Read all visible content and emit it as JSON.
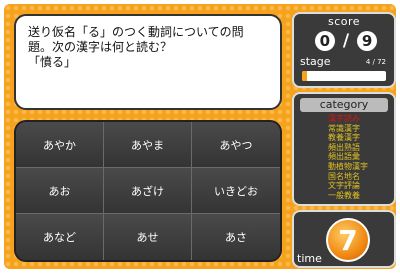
{
  "question": {
    "line1": "送り仮名「る」のつく動詞についての問",
    "line2": "題。次の漢字は何と読む？",
    "line3": "「憤る」"
  },
  "answers": [
    "あやか",
    "あやま",
    "あやつ",
    "あお",
    "あざけ",
    "いきどお",
    "あなど",
    "あせ",
    "あさ"
  ],
  "score": {
    "title": "score",
    "correct": "0",
    "sep": "/",
    "total": "9"
  },
  "stage": {
    "label": "stage",
    "value": "4 / 72",
    "progress": 0.06
  },
  "category": {
    "title": "category",
    "items": [
      {
        "label": "漢字読み",
        "color": "#d01818"
      },
      {
        "label": "常識漢字",
        "color": "#e0c020"
      },
      {
        "label": "教養漢字",
        "color": "#e0c020"
      },
      {
        "label": "頻出熟語",
        "color": "#e0c020"
      },
      {
        "label": "頻出語彙",
        "color": "#e0c020"
      },
      {
        "label": "動植物漢字",
        "color": "#e0c020"
      },
      {
        "label": "国名地名",
        "color": "#e0c020"
      },
      {
        "label": "文字評論",
        "color": "#e0c020"
      },
      {
        "label": "一般教養",
        "color": "#e0c020"
      }
    ]
  },
  "time": {
    "label": "time",
    "value": "7"
  },
  "colors": {
    "frame": "#f6a21a",
    "panel": "#3a3a3a",
    "accent": "#f08a12"
  }
}
